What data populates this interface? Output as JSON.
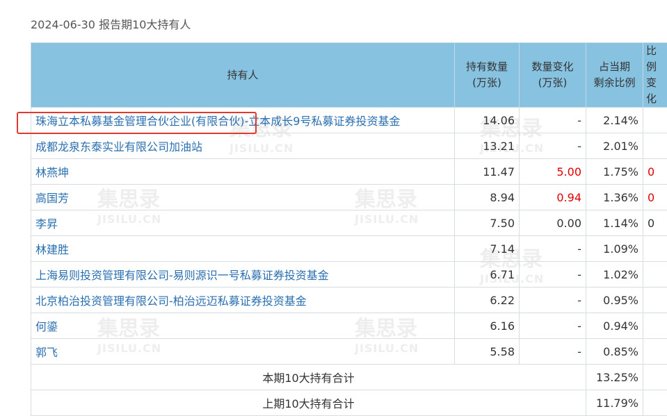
{
  "title": "2024-06-30 报告期10大持有人",
  "headers": {
    "holder": "持有人",
    "qty": "持有数量\n(万张)",
    "change": "数量变化\n(万张)",
    "ratio": "占当期\n剩余比例",
    "ratio_change": "比例\n变化"
  },
  "rows": [
    {
      "name": "珠海立本私募基金管理合伙企业(有限合伙)-立本成长9号私募证券投资基金",
      "qty": "14.06",
      "change": "-",
      "ratio": "2.14%",
      "ratio_change": ""
    },
    {
      "name": "成都龙泉东泰实业有限公司加油站",
      "qty": "13.21",
      "change": "-",
      "ratio": "2.01%",
      "ratio_change": ""
    },
    {
      "name": "林燕坤",
      "qty": "11.47",
      "change": "5.00",
      "ratio": "1.75%",
      "ratio_change": "0"
    },
    {
      "name": "高国芳",
      "qty": "8.94",
      "change": "0.94",
      "ratio": "1.36%",
      "ratio_change": "0"
    },
    {
      "name": "李昇",
      "qty": "7.50",
      "change": "0.00",
      "ratio": "1.14%",
      "ratio_change": "0"
    },
    {
      "name": "林建胜",
      "qty": "7.14",
      "change": "-",
      "ratio": "1.09%",
      "ratio_change": ""
    },
    {
      "name": "上海易则投资管理有限公司-易则源识一号私募证券投资基金",
      "qty": "6.71",
      "change": "-",
      "ratio": "1.02%",
      "ratio_change": ""
    },
    {
      "name": "北京柏治投资管理有限公司-柏治远迈私募证券投资基金",
      "qty": "6.22",
      "change": "-",
      "ratio": "0.95%",
      "ratio_change": ""
    },
    {
      "name": "何鎏",
      "qty": "6.16",
      "change": "-",
      "ratio": "0.94%",
      "ratio_change": ""
    },
    {
      "name": "郭飞",
      "qty": "5.58",
      "change": "-",
      "ratio": "0.85%",
      "ratio_change": ""
    }
  ],
  "summary": [
    {
      "label": "本期10大持有合计",
      "ratio": "13.25%"
    },
    {
      "label": "上期10大持有合计",
      "ratio": "11.79%"
    }
  ],
  "watermark": {
    "zh": "集思录",
    "en": "JISILU.CN"
  },
  "colors": {
    "header_bg": "#87c3e0",
    "link": "#2a6fb0",
    "increase": "#e00000",
    "highlight": "#e03a30"
  }
}
